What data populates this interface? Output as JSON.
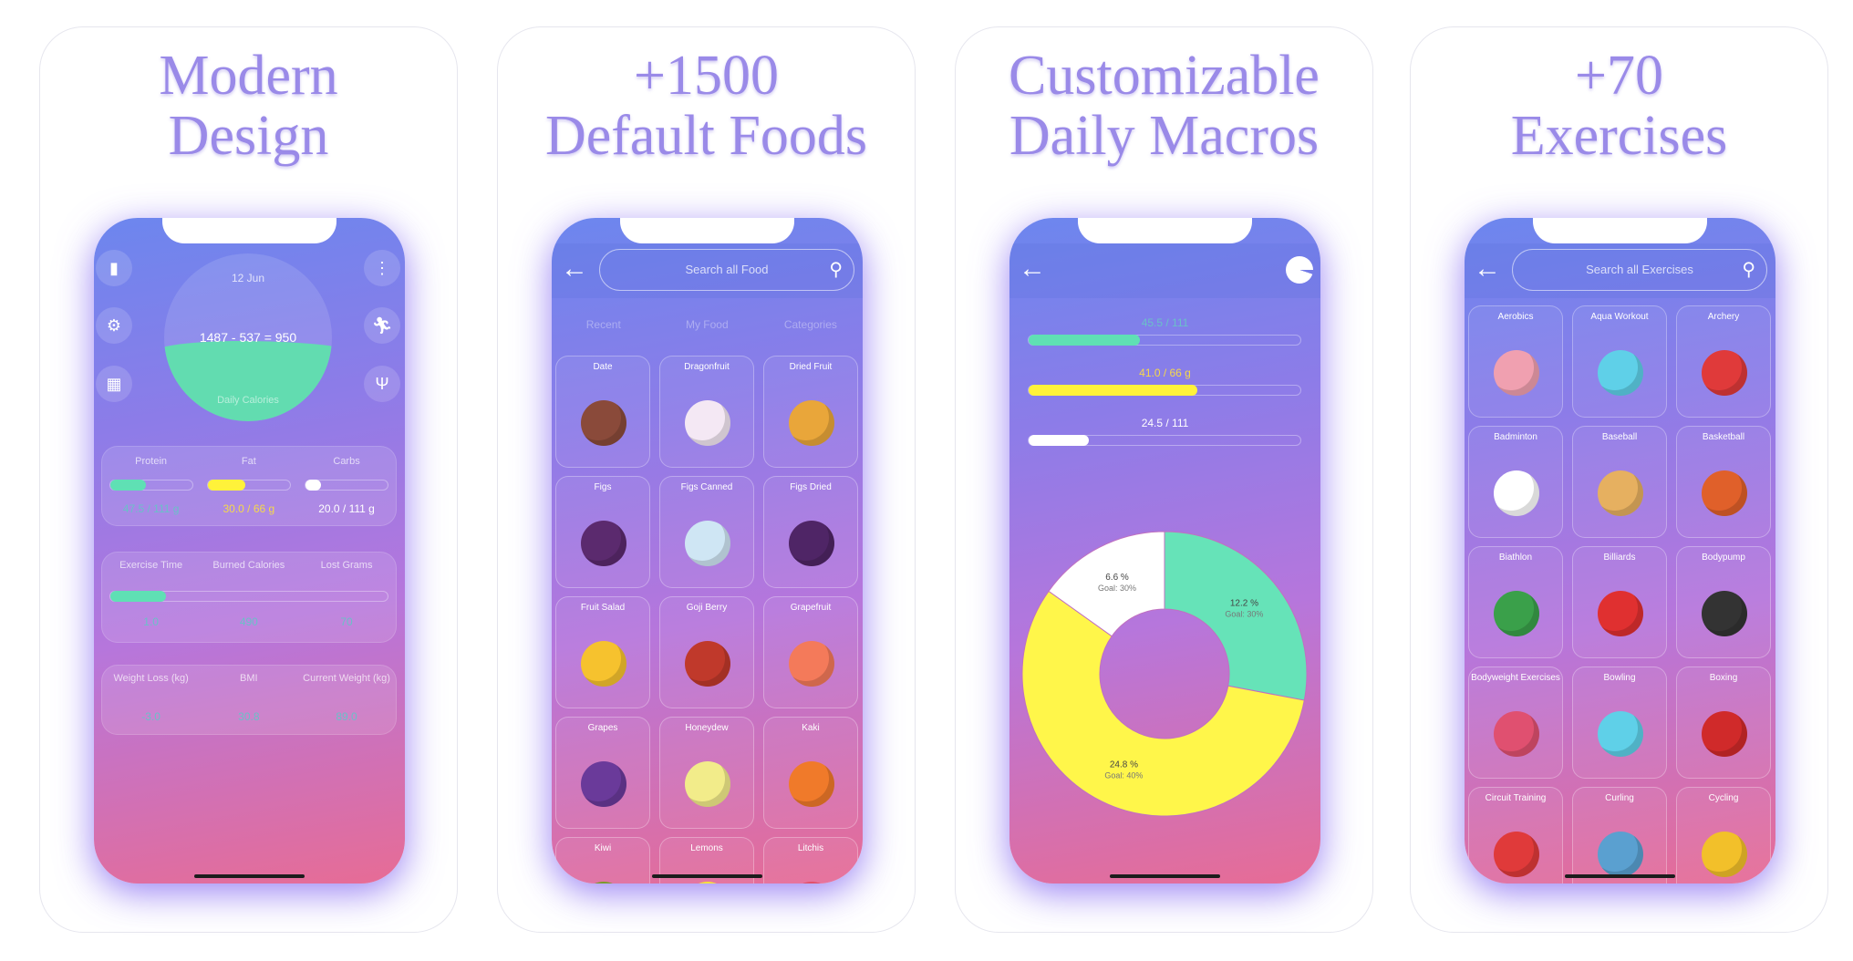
{
  "cards": [
    {
      "title_line1": "Modern",
      "title_line2": "Design"
    },
    {
      "title_line1": "+1500",
      "title_line2": "Default Foods"
    },
    {
      "title_line1": "Customizable",
      "title_line2": "Daily Macros"
    },
    {
      "title_line1": "+70",
      "title_line2": "Exercises"
    }
  ],
  "dashboard": {
    "date": "12 Jun",
    "equation": "1487 - 537 = 950",
    "daily_calories_label": "Daily Calories",
    "calorie_fill_pct": 48,
    "icons": [
      "bar-chart-icon",
      "settings-icon",
      "calendar-icon",
      "more-icon",
      "running-icon",
      "fork-knife-icon"
    ],
    "macros": [
      {
        "label": "Protein",
        "value": "47.5 / 111 g",
        "fraction": 0.43,
        "color": "#5fe0b4"
      },
      {
        "label": "Fat",
        "value": "30.0 / 66 g",
        "fraction": 0.45,
        "color": "#fff23a"
      },
      {
        "label": "Carbs",
        "value": "20.0 / 111 g",
        "fraction": 0.18,
        "color": "#ffffff"
      }
    ],
    "exercise": {
      "labels": [
        "Exercise Time",
        "Burned Calories",
        "Lost Grams"
      ],
      "values": [
        "1.0",
        "490",
        "70"
      ],
      "fraction": 0.2
    },
    "weight": {
      "labels": [
        "Weight Loss (kg)",
        "BMI",
        "Current Weight (kg)"
      ],
      "values": [
        "-3.0",
        "30.8",
        "89.0"
      ]
    }
  },
  "foods": {
    "search_placeholder": "Search all Food",
    "tabs": [
      "Recent",
      "My Food",
      "Categories"
    ],
    "items": [
      {
        "name": "Date",
        "color": "#8a4a3a"
      },
      {
        "name": "Dragonfruit",
        "color": "#f4e8f4"
      },
      {
        "name": "Dried Fruit",
        "color": "#e9a63a"
      },
      {
        "name": "Figs",
        "color": "#5b2a6e"
      },
      {
        "name": "Figs Canned",
        "color": "#cfe6f4"
      },
      {
        "name": "Figs Dried",
        "color": "#4f2566"
      },
      {
        "name": "Fruit Salad",
        "color": "#f6c22e"
      },
      {
        "name": "Goji Berry",
        "color": "#c0392b"
      },
      {
        "name": "Grapefruit",
        "color": "#f47a5a"
      },
      {
        "name": "Grapes",
        "color": "#6a3a9a"
      },
      {
        "name": "Honeydew",
        "color": "#f2ec8a"
      },
      {
        "name": "Kaki",
        "color": "#f07a2a"
      },
      {
        "name": "Kiwi",
        "color": "#7a9a2a"
      },
      {
        "name": "Lemons",
        "color": "#f6e23a"
      },
      {
        "name": "Litchis",
        "color": "#e0506a"
      }
    ]
  },
  "macros_screen": {
    "bars": [
      {
        "label": "45.5 / 111",
        "fraction": 0.41,
        "color": "#5fe0b4"
      },
      {
        "label": "41.0 / 66 g",
        "fraction": 0.62,
        "color": "#fff23a"
      },
      {
        "label": "24.5 / 111",
        "fraction": 0.22,
        "color": "#ffffff"
      }
    ],
    "chart_data": {
      "type": "pie",
      "donut": true,
      "slices": [
        {
          "value": 12.2,
          "label": "12.2 %",
          "goal": "Goal: 30%",
          "color": "#66e3b8"
        },
        {
          "value": 24.8,
          "label": "24.8 %",
          "goal": "Goal: 40%",
          "color": "#fff64a"
        },
        {
          "value": 6.6,
          "label": "6.6 %",
          "goal": "Goal: 30%",
          "color": "#ffffff"
        }
      ]
    }
  },
  "exercises": {
    "search_placeholder": "Search all Exercises",
    "items": [
      {
        "name": "Aerobics",
        "color": "#f0a0b0"
      },
      {
        "name": "Aqua Workout",
        "color": "#5fd0e8"
      },
      {
        "name": "Archery",
        "color": "#e03a3a"
      },
      {
        "name": "Badminton",
        "color": "#ffffff"
      },
      {
        "name": "Baseball",
        "color": "#e6b060"
      },
      {
        "name": "Basketball",
        "color": "#e0602a"
      },
      {
        "name": "Biathlon",
        "color": "#3aa04a"
      },
      {
        "name": "Billiards",
        "color": "#e03030"
      },
      {
        "name": "Bodypump",
        "color": "#333333"
      },
      {
        "name": "Bodyweight Exercises",
        "color": "#e05070"
      },
      {
        "name": "Bowling",
        "color": "#5fd0e8"
      },
      {
        "name": "Boxing",
        "color": "#d02a2a"
      },
      {
        "name": "Circuit Training",
        "color": "#e03a3a"
      },
      {
        "name": "Curling",
        "color": "#5aa0d0"
      },
      {
        "name": "Cycling",
        "color": "#f2c02a"
      }
    ]
  }
}
